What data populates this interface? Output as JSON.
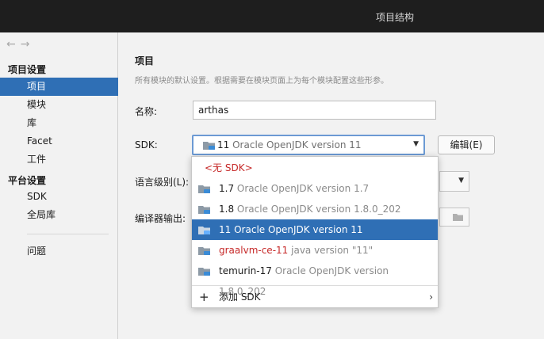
{
  "window": {
    "title": "项目结构"
  },
  "nav": {
    "back_glyph": "←",
    "forward_glyph": "→"
  },
  "sidebar": {
    "section_project": "项目设置",
    "items_project": [
      {
        "label": "项目",
        "selected": true
      },
      {
        "label": "模块",
        "selected": false
      },
      {
        "label": "库",
        "selected": false
      },
      {
        "label": "Facet",
        "selected": false
      },
      {
        "label": "工件",
        "selected": false
      }
    ],
    "section_platform": "平台设置",
    "items_platform": [
      {
        "label": "SDK"
      },
      {
        "label": "全局库"
      }
    ],
    "problems": "问题"
  },
  "main": {
    "heading": "项目",
    "description": "所有模块的默认设置。根据需要在模块页面上为每个模块配置这些形参。",
    "name_label": "名称:",
    "name_value": "arthas",
    "sdk_label": "SDK:",
    "sdk_selected_name": "11",
    "sdk_selected_version": "Oracle OpenJDK version 11",
    "edit_button": "编辑(E)",
    "language_level_label": "语言级别(L):",
    "compiler_output_label": "编译器输出:"
  },
  "sdk_popup": {
    "no_sdk": "<无 SDK>",
    "items": [
      {
        "name": "1.7",
        "version": "Oracle OpenJDK version 1.7",
        "selected": false,
        "red": false
      },
      {
        "name": "1.8",
        "version": "Oracle OpenJDK version 1.8.0_202",
        "selected": false,
        "red": false
      },
      {
        "name": "11",
        "version": "Oracle OpenJDK version 11",
        "selected": true,
        "red": false
      },
      {
        "name": "graalvm-ce-11",
        "version": "java version \"11\"",
        "selected": false,
        "red": true
      },
      {
        "name": "temurin-17",
        "version": "Oracle OpenJDK version 1.8.0_202",
        "selected": false,
        "red": false
      }
    ],
    "add_sdk": "添加 SDK"
  },
  "colors": {
    "accent": "#2f6fb5",
    "titlebar": "#1e1e1e",
    "error_red": "#c62828"
  },
  "icons": [
    "back-arrow-icon",
    "forward-arrow-icon",
    "sdk-folder-icon",
    "dropdown-arrow-icon",
    "plus-icon",
    "chevron-right-icon"
  ]
}
